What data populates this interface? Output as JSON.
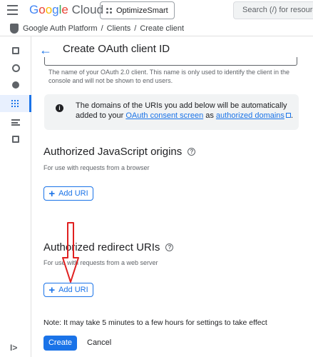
{
  "topbar": {
    "logo": {
      "g1": "G",
      "g2": "o",
      "g3": "o",
      "g4": "g",
      "g5": "l",
      "g6": "e",
      "cloud": "Cloud"
    },
    "project": "OptimizeSmart",
    "search_placeholder": "Search (/) for resources"
  },
  "breadcrumb": {
    "items": [
      "Google Auth Platform",
      "Clients",
      "Create client"
    ],
    "separator": "/"
  },
  "rail": {
    "icons": [
      "dashboard-icon",
      "palette-icon",
      "person-icon",
      "grid-icon",
      "list-settings-icon",
      "checkbox-icon"
    ],
    "expand": "I>"
  },
  "page": {
    "back": "←",
    "title": "Create OAuth client ID"
  },
  "name_hint": "The name of your OAuth 2.0 client. This name is only used to identify the client in the console and will not be shown to end users.",
  "info": {
    "icon": "i",
    "text_1": "The domains of the URIs you add below will be automatically added to your ",
    "link_1": "OAuth consent screen",
    "text_2": " as ",
    "link_2": "authorized domains",
    "text_3": "."
  },
  "js_origins": {
    "title": "Authorized JavaScript origins",
    "help": "?",
    "desc": "For use with requests from a browser",
    "add_label": "Add URI",
    "plus": "+"
  },
  "redirect_uris": {
    "title": "Authorized redirect URIs",
    "help": "?",
    "desc": "For use with requests from a web server",
    "add_label": "Add URI",
    "plus": "+"
  },
  "note": "Note: It may take 5 minutes to a few hours for settings to take effect",
  "actions": {
    "create": "Create",
    "cancel": "Cancel"
  },
  "colors": {
    "accent": "#1a73e8",
    "annotation": "#e02020"
  }
}
